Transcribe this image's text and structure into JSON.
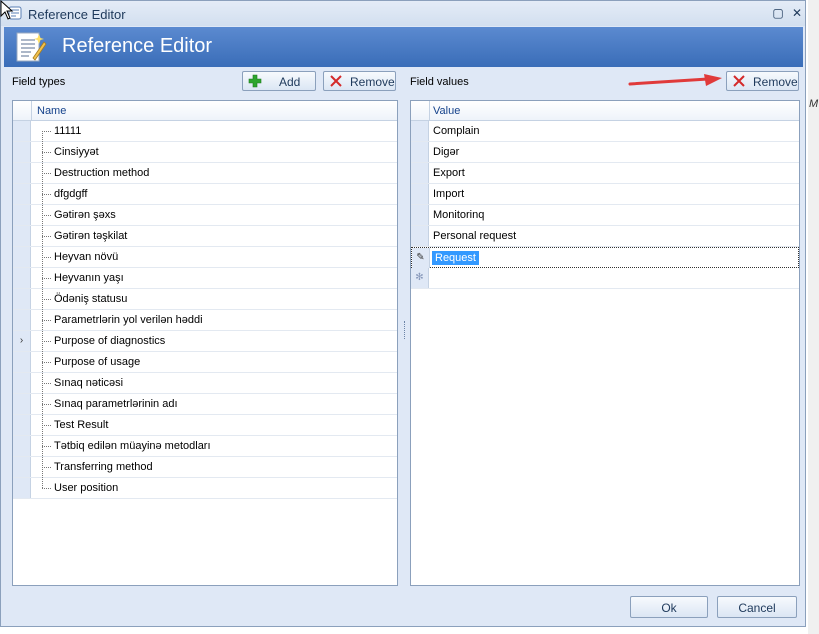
{
  "window": {
    "title": "Reference Editor",
    "header_title": "Reference Editor"
  },
  "left_panel": {
    "label": "Field types",
    "add_label": "Add",
    "remove_label": "Remove",
    "column_header": "Name",
    "current_row_index": 10,
    "items": [
      "11111",
      "Cinsiyyət",
      "Destruction method",
      "dfgdgff",
      "Gətirən şəxs",
      "Gətirən təşkilat",
      "Heyvan növü",
      "Heyvanın yaşı",
      "Ödəniş statusu",
      "Parametrlərin yol verilən həddi",
      "Purpose of diagnostics",
      "Purpose of usage",
      "Sınaq nəticəsi",
      "Sınaq parametrlərinin adı",
      "Test Result",
      "Tətbiq edilən müayinə metodları",
      "Transferring method",
      "User position"
    ]
  },
  "right_panel": {
    "label": "Field values",
    "remove_label": "Remove",
    "column_header": "Value",
    "items": [
      "Complain",
      "Digər",
      "Export",
      "Import",
      "Monitorinq",
      "Personal request"
    ],
    "editing_value": "Request"
  },
  "footer": {
    "ok_label": "Ok",
    "cancel_label": "Cancel"
  },
  "background": {
    "partial_text": "M"
  },
  "colors": {
    "header_blue": "#3a6db8",
    "selection_blue": "#3399ff",
    "arrow_red": "#e03a3a",
    "add_green": "#2ea52e",
    "remove_red": "#d42a2a"
  }
}
